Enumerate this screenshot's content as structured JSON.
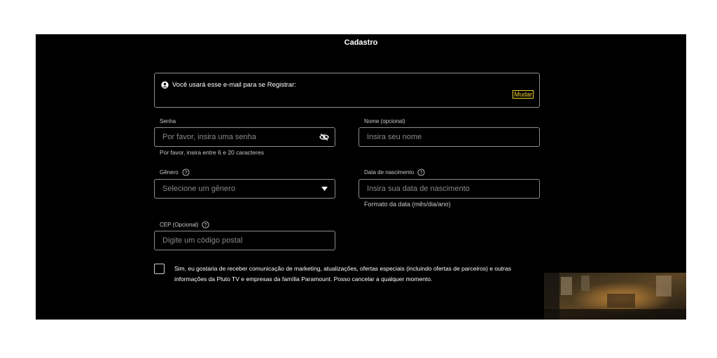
{
  "form": {
    "title": "Cadastro",
    "email_notice": "Você usará esse e-mail para se Registrar:",
    "change_link": "Mudar",
    "password": {
      "label": "Senha",
      "placeholder": "Por favor, insira uma senha",
      "hint": "Por favor, insira entre 6 e 20 caracteres"
    },
    "name": {
      "label": "Nome (opcional)",
      "placeholder": "Insira seu nome"
    },
    "gender": {
      "label": "Gênero",
      "placeholder": "Selecione um gênero"
    },
    "birthdate": {
      "label": "Data de nascimento",
      "placeholder": "Insira sua data de nascimento",
      "hint": "Formato da data (mês/dia/ano)"
    },
    "postal": {
      "label": "CEP (Opcional)",
      "placeholder": "Digite um código postal"
    },
    "consent": "Sim, eu gostaria de receber comunicação de marketing, atualizações, ofertas especiais (incluindo ofertas de parceiros) e outras informações da Pluto TV e empresas da família Paramount. Posso cancelar a qualquer momento."
  },
  "colors": {
    "background": "#000000",
    "accent": "#f6d32c",
    "border": "#8e8e8e"
  },
  "icons": [
    "user-circle-icon",
    "eye-slash-icon",
    "help-circle-icon",
    "caret-down-icon"
  ]
}
